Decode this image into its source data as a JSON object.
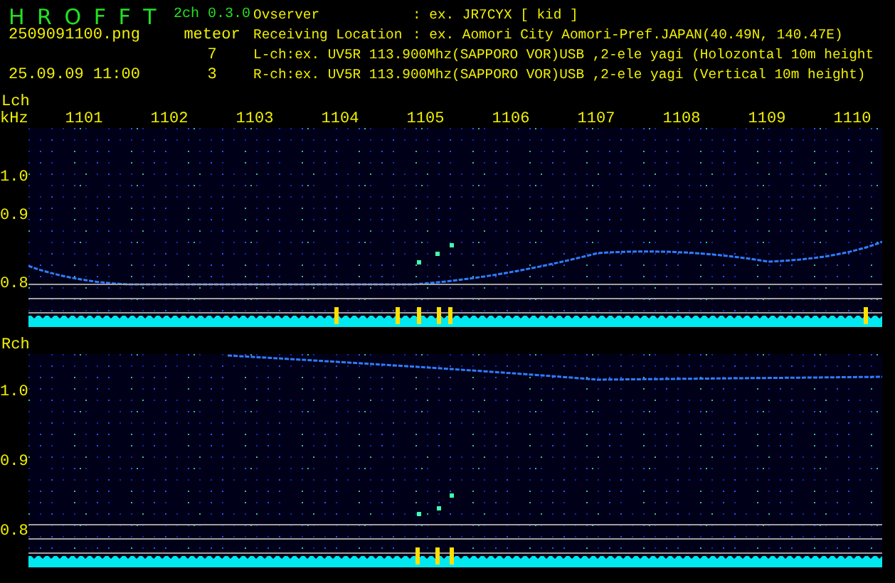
{
  "app": {
    "title": "H R O F F T",
    "version": "2ch 0.3.0"
  },
  "file_name": "2509091100.png",
  "timestamp": "25.09.09 11:00",
  "meteor": {
    "label": "meteor",
    "counts": [
      "7",
      "3"
    ]
  },
  "info_lines": [
    {
      "kind": "field",
      "label": "Ovserver",
      "value": ": ex. JR7CYX [ kid ]"
    },
    {
      "kind": "field",
      "label": "Receiving Location",
      "value": ": ex. Aomori City Aomori-Pref.JAPAN(40.49N, 140.47E)"
    },
    {
      "kind": "line",
      "value": "L-ch:ex. UV5R 113.900Mhz(SAPPORO VOR)USB ,2-ele yagi (Holozontal 10m height"
    },
    {
      "kind": "line",
      "value": "R-ch:ex. UV5R 113.900Mhz(SAPPORO VOR)USB ,2-ele yagi (Vertical 10m height)"
    }
  ],
  "channels": [
    {
      "label": "Lch",
      "unit": "kHz",
      "minute_labels": [
        "1101",
        "1102",
        "1103",
        "1104",
        "1105",
        "1106",
        "1107",
        "1108",
        "1109",
        "1110"
      ],
      "y_labels": [
        "1.0",
        "0.9",
        "0.8"
      ]
    },
    {
      "label": "Rch",
      "y_labels": [
        "1.0",
        "0.9",
        "0.8"
      ]
    }
  ]
}
